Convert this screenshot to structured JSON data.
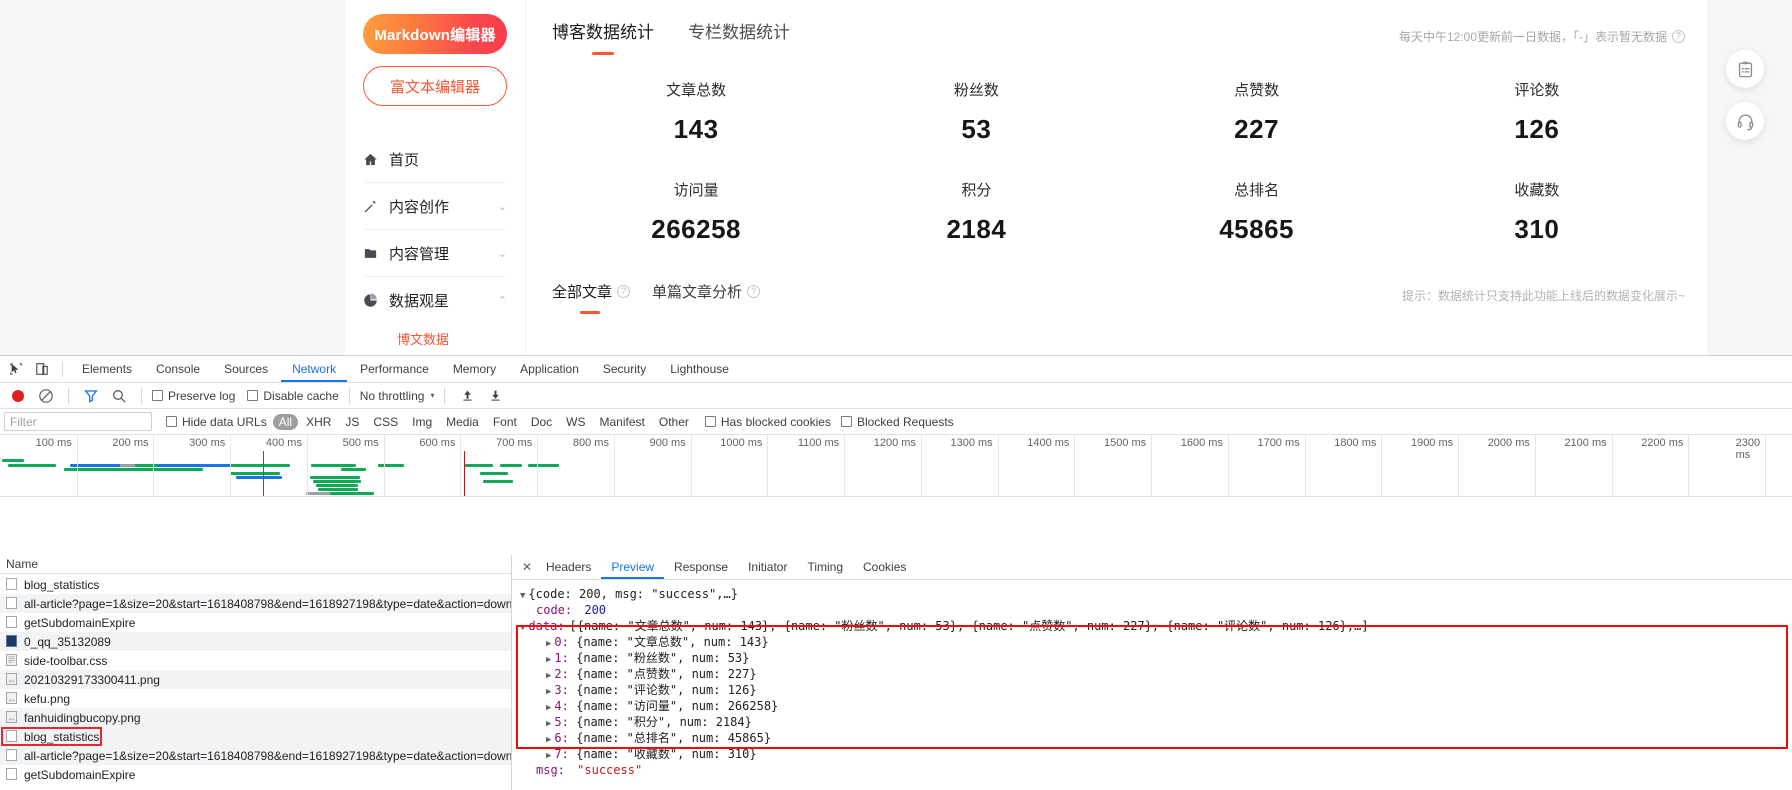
{
  "website": {
    "sidebar": {
      "markdown_button": "Markdown编辑器",
      "rich_text_button": "富文本编辑器",
      "nav": [
        {
          "label": "首页",
          "icon": "home-icon",
          "chevron": ""
        },
        {
          "label": "内容创作",
          "icon": "pencil-icon",
          "chevron": "⌄"
        },
        {
          "label": "内容管理",
          "icon": "folder-icon",
          "chevron": "⌄"
        },
        {
          "label": "数据观星",
          "icon": "pie-chart-icon",
          "chevron": "⌃"
        }
      ],
      "sub_item": "博文数据"
    },
    "tabs": [
      {
        "label": "博客数据统计",
        "active": true
      },
      {
        "label": "专栏数据统计",
        "active": false
      }
    ],
    "top_note": "每天中午12:00更新前一日数据，「-」表示暂无数据",
    "top_note_help": "?",
    "stats": [
      {
        "name": "文章总数",
        "value": "143"
      },
      {
        "name": "粉丝数",
        "value": "53"
      },
      {
        "name": "点赞数",
        "value": "227"
      },
      {
        "name": "评论数",
        "value": "126"
      },
      {
        "name": "访问量",
        "value": "266258"
      },
      {
        "name": "积分",
        "value": "2184"
      },
      {
        "name": "总排名",
        "value": "45865"
      },
      {
        "name": "收藏数",
        "value": "310"
      }
    ],
    "sub_tabs": [
      {
        "label": "全部文章",
        "help": "?",
        "active": true
      },
      {
        "label": "单篇文章分析",
        "help": "?",
        "active": false
      }
    ],
    "sub_note": "提示：数据统计只支持此功能上线后的数据变化展示~",
    "rail": [
      {
        "icon": "clipboard-icon"
      },
      {
        "icon": "headset-icon"
      }
    ],
    "accent_color": "#fc5531"
  },
  "devtools": {
    "panels": [
      "Elements",
      "Console",
      "Sources",
      "Network",
      "Performance",
      "Memory",
      "Application",
      "Security",
      "Lighthouse"
    ],
    "active_panel": "Network",
    "toolbar": {
      "record_tooltip": "record",
      "clear_tooltip": "clear",
      "filter_tooltip": "filter",
      "search_tooltip": "search",
      "preserve_log": "Preserve log",
      "disable_cache": "Disable cache",
      "throttling": "No throttling",
      "caret": "▾",
      "import_icon": "upload-icon",
      "export_icon": "download-icon"
    },
    "filterbar": {
      "filter_placeholder": "Filter",
      "hide_data_urls": "Hide data URLs",
      "types": [
        "All",
        "XHR",
        "JS",
        "CSS",
        "Img",
        "Media",
        "Font",
        "Doc",
        "WS",
        "Manifest",
        "Other"
      ],
      "active_type": "All",
      "has_blocked_cookies": "Has blocked cookies",
      "blocked_requests": "Blocked Requests"
    },
    "timeline": {
      "ticks": [
        "100 ms",
        "200 ms",
        "300 ms",
        "400 ms",
        "500 ms",
        "600 ms",
        "700 ms",
        "800 ms",
        "900 ms",
        "1000 ms",
        "1100 ms",
        "1200 ms",
        "1300 ms",
        "1400 ms",
        "1500 ms",
        "1600 ms",
        "1700 ms",
        "1800 ms",
        "1900 ms",
        "2000 ms",
        "2100 ms",
        "2200 ms",
        "2300 ms"
      ],
      "dcl_marker_color": "#0b7b77",
      "load_marker_color": "#b51c1c"
    },
    "requests": {
      "column_header": "Name",
      "rows": [
        {
          "name": "blog_statistics",
          "icon": "xhr-icon",
          "selected": false
        },
        {
          "name": "all-article?page=1&size=20&start=1618408798&end=1618927198&type=date&action=down",
          "icon": "xhr-icon",
          "selected": false
        },
        {
          "name": "getSubdomainExpire",
          "icon": "xhr-icon",
          "selected": false
        },
        {
          "name": "0_qq_35132089",
          "icon": "doc-icon",
          "selected": false
        },
        {
          "name": "side-toolbar.css",
          "icon": "css-icon",
          "selected": false
        },
        {
          "name": "20210329173300411.png",
          "icon": "img-icon",
          "selected": false
        },
        {
          "name": "kefu.png",
          "icon": "img-icon",
          "selected": false
        },
        {
          "name": "fanhuidingbucopy.png",
          "icon": "img-icon",
          "selected": false
        },
        {
          "name": "blog_statistics",
          "icon": "xhr-icon",
          "selected": true
        },
        {
          "name": "all-article?page=1&size=20&start=1618408798&end=1618927198&type=date&action=down",
          "icon": "xhr-icon",
          "selected": false
        },
        {
          "name": "getSubdomainExpire",
          "icon": "xhr-icon",
          "selected": false
        }
      ]
    },
    "detail": {
      "close_label": "✕",
      "tabs": [
        "Headers",
        "Preview",
        "Response",
        "Initiator",
        "Timing",
        "Cookies"
      ],
      "active_tab": "Preview",
      "preview": {
        "root": "{code: 200, msg: \"success\",…}",
        "code_key": "code:",
        "code_value": "200",
        "data_key": "data:",
        "data_summary": "[{name: \"文章总数\", num: 143}, {name: \"粉丝数\", num: 53}, {name: \"点赞数\", num: 227}, {name: \"评论数\", num: 126},…]",
        "items": [
          {
            "index": "0:",
            "text": "{name: \"文章总数\", num: 143}"
          },
          {
            "index": "1:",
            "text": "{name: \"粉丝数\", num: 53}"
          },
          {
            "index": "2:",
            "text": "{name: \"点赞数\", num: 227}"
          },
          {
            "index": "3:",
            "text": "{name: \"评论数\", num: 126}"
          },
          {
            "index": "4:",
            "text": "{name: \"访问量\", num: 266258}"
          },
          {
            "index": "5:",
            "text": "{name: \"积分\", num: 2184}"
          },
          {
            "index": "6:",
            "text": "{name: \"总排名\", num: 45865}"
          },
          {
            "index": "7:",
            "text": "{name: \"收藏数\", num: 310}"
          }
        ],
        "msg_key": "msg:",
        "msg_value": "\"success\""
      }
    }
  }
}
